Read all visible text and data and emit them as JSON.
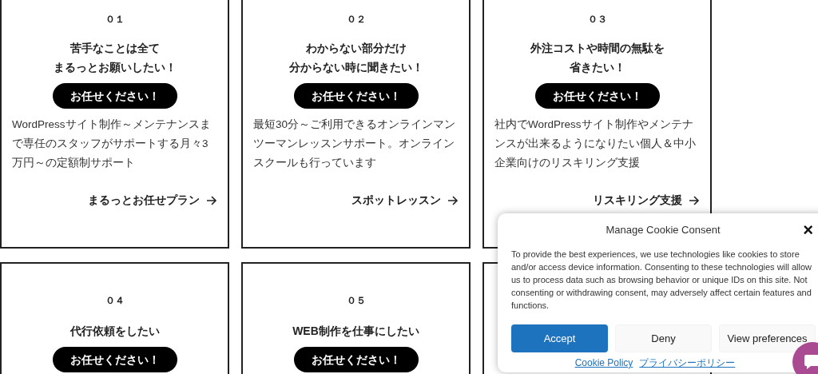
{
  "cards": [
    {
      "number": "０１",
      "title_lines": [
        "苦手なことは全て",
        "まるっとお願いしたい！"
      ],
      "button": "お任せください！",
      "description": "WordPressサイト制作～メンテナンスまで専任のスタッフがサポートする月々3万円～の定額制サポート",
      "link": "まるっとお任せプラン"
    },
    {
      "number": "０２",
      "title_lines": [
        "わからない部分だけ",
        "分からない時に聞きたい！"
      ],
      "button": "お任せください！",
      "description": "最短30分～ご利用できるオンラインマンツーマンレッスンサポート。オンラインスクールも行っています",
      "link": "スポットレッスン"
    },
    {
      "number": "０３",
      "title_lines": [
        "外注コストや時間の無駄を",
        "省きたい！"
      ],
      "button": "お任せください！",
      "description": "社内でWordPressサイト制作やメンテナンスが出来るようになりたい個人＆中小企業向けのリスキリング支援",
      "link": "リスキリング支援"
    },
    {
      "number": "０４",
      "title_lines": [
        "代行依頼をしたい"
      ],
      "button": "お任せください！"
    },
    {
      "number": "０５",
      "title_lines": [
        "WEB制作を仕事にしたい"
      ],
      "button": "お任せください！"
    }
  ],
  "cookie_dialog": {
    "title": "Manage Cookie Consent",
    "close": "×",
    "text": "To provide the best experiences, we use technologies like cookies to store and/or access device information. Consenting to these technologies will allow us to process data such as browsing behavior or unique IDs on this site. Not consenting or withdrawing consent, may adversely affect certain features and functions.",
    "buttons": [
      {
        "label": "Accept",
        "kind": "primary"
      },
      {
        "label": "Deny",
        "kind": "secondary"
      },
      {
        "label": "View preferences",
        "kind": "secondary"
      }
    ],
    "links": [
      "Cookie Policy",
      "プライバシーポリシー"
    ]
  }
}
